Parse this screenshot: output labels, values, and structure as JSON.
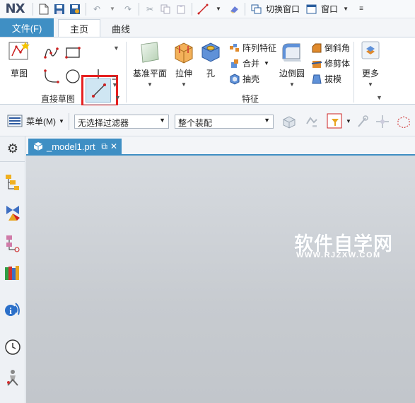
{
  "app": {
    "logo": "NX"
  },
  "quick_access": {
    "switch_window": "切换窗口",
    "window": "窗口"
  },
  "tabs": {
    "file": "文件(F)",
    "home": "主页",
    "curve": "曲线"
  },
  "ribbon": {
    "direct_sketch": {
      "sketch": "草图",
      "group": "直接草图"
    },
    "feature": {
      "datum_plane": "基准平面",
      "extrude": "拉伸",
      "hole": "孔",
      "pattern_feature": "阵列特征",
      "unite": "合并",
      "shell": "抽壳",
      "edge_blend": "边倒圆",
      "chamfer": "倒斜角",
      "trim_body": "修剪体",
      "draft": "拔模",
      "more": "更多",
      "group": "特征"
    }
  },
  "selection_bar": {
    "menu": "菜单(M)",
    "type_filter": "无选择过滤器",
    "scope": "整个装配"
  },
  "document": {
    "tab_name": "_model1.prt"
  },
  "watermark": {
    "title": "软件自学网",
    "url": "WWW.RJZXW.COM"
  },
  "colors": {
    "accent": "#3f8fc4",
    "highlight": "#e62020"
  }
}
